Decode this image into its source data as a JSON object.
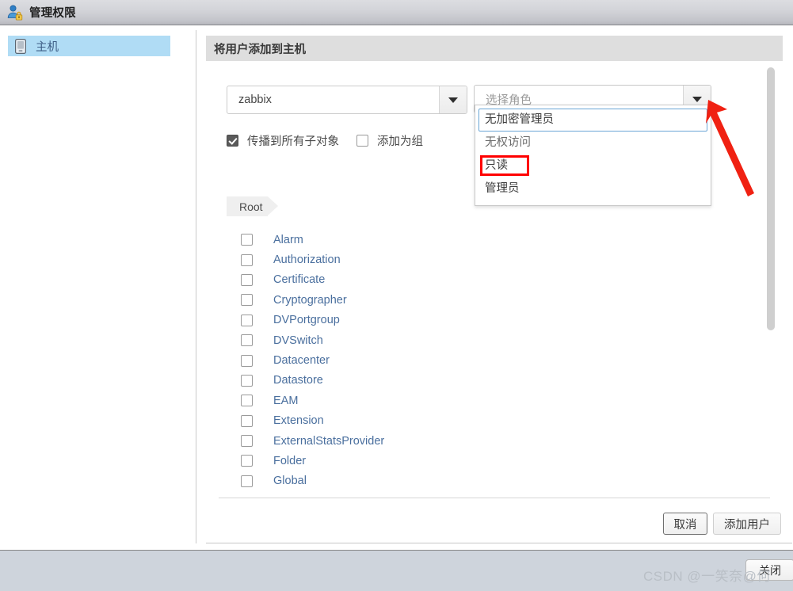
{
  "window": {
    "title": "管理权限",
    "icon": "user-lock-icon"
  },
  "sidebar": {
    "items": [
      {
        "label": "主机",
        "icon": "host-icon",
        "selected": true
      }
    ]
  },
  "panel": {
    "title": "将用户添加到主机"
  },
  "user_select": {
    "name": "user-domain-select",
    "value": "zabbix",
    "caret_icon": "chevron-down-icon"
  },
  "role_select": {
    "name": "role-select",
    "placeholder": "选择角色",
    "value": "",
    "caret_icon": "chevron-down-icon",
    "expanded": true,
    "options": [
      {
        "label": "无加密管理员",
        "focused": true,
        "highlighted": false
      },
      {
        "label": "无权访问",
        "focused": false,
        "highlighted": false
      },
      {
        "label": "只读",
        "focused": false,
        "highlighted": true
      },
      {
        "label": "管理员",
        "focused": false,
        "highlighted": false
      }
    ]
  },
  "options_row": {
    "propagate": {
      "label": "传播到所有子对象",
      "checked": true
    },
    "add_as_group": {
      "label": "添加为组",
      "checked": false
    }
  },
  "breadcrumb": {
    "label": "Root"
  },
  "privileges": [
    {
      "label": "Alarm",
      "checked": false
    },
    {
      "label": "Authorization",
      "checked": false
    },
    {
      "label": "Certificate",
      "checked": false
    },
    {
      "label": "Cryptographer",
      "checked": false
    },
    {
      "label": "DVPortgroup",
      "checked": false
    },
    {
      "label": "DVSwitch",
      "checked": false
    },
    {
      "label": "Datacenter",
      "checked": false
    },
    {
      "label": "Datastore",
      "checked": false
    },
    {
      "label": "EAM",
      "checked": false
    },
    {
      "label": "Extension",
      "checked": false
    },
    {
      "label": "ExternalStatsProvider",
      "checked": false
    },
    {
      "label": "Folder",
      "checked": false
    },
    {
      "label": "Global",
      "checked": false
    }
  ],
  "footer": {
    "cancel_label": "取消",
    "add_user_label": "添加用户"
  },
  "statusbar": {
    "close_label": "关闭",
    "watermark": "CSDN @一笑奈@何"
  },
  "annotation": {
    "arrow_color": "#f02112",
    "highlight_color": "#ff0000"
  },
  "colors": {
    "titlebar_top": "#dcdde1",
    "titlebar_bottom": "#b7b8be",
    "nav_selected": "#b0dcf5",
    "panel_header": "#dedede",
    "link_blue": "#4a6f9e",
    "statusbar": "#ced4dc"
  }
}
